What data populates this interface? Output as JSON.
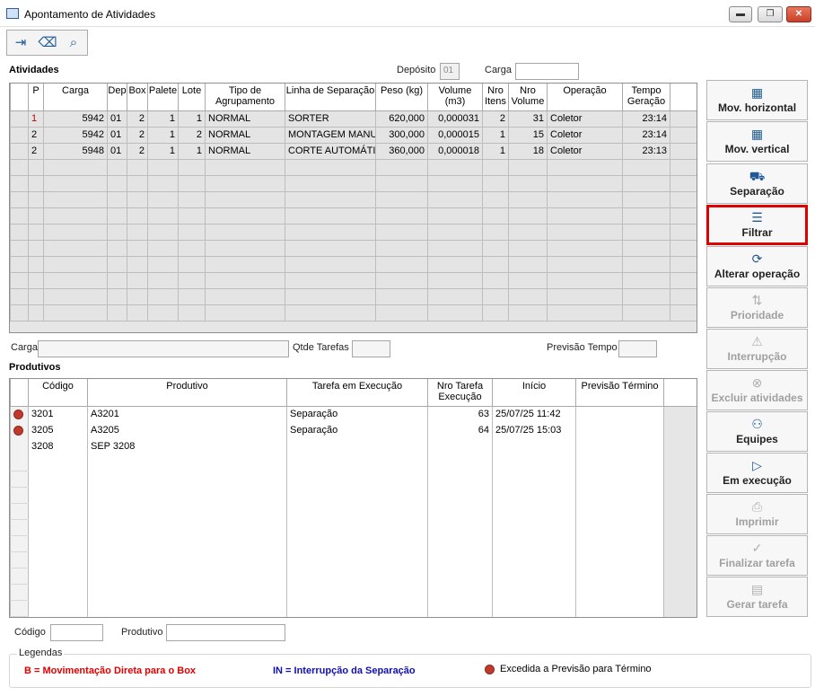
{
  "window": {
    "title": "Apontamento de Atividades",
    "minimize_label": "▬",
    "maximize_label": "❐",
    "close_label": "✕"
  },
  "toolbar": {
    "exit_icon": "exit-icon",
    "eraser_icon": "eraser-icon",
    "search_icon": "search-icon"
  },
  "atividades": {
    "section_title": "Atividades",
    "deposito_label": "Depósito",
    "deposito_value": "01",
    "carga_label": "Carga",
    "carga_value": "",
    "columns": [
      "P",
      "Carga",
      "Dep",
      "Box",
      "Palete",
      "Lote",
      "Tipo de Agrupamento",
      "Linha de Separação",
      "Peso (kg)",
      "Volume (m3)",
      "Nro Itens",
      "Nro Volume",
      "Operação",
      "Tempo Geração"
    ],
    "rows": [
      {
        "p": "1",
        "carga": "5942",
        "dep": "01",
        "box": "2",
        "palete": "1",
        "lote": "1",
        "tipo": "NORMAL",
        "linha": "SORTER",
        "peso": "620,000",
        "volume": "0,000031",
        "itens": "2",
        "nro_volume": "31",
        "operacao": "Coletor",
        "tempo": "23:14"
      },
      {
        "p": "2",
        "carga": "5942",
        "dep": "01",
        "box": "2",
        "palete": "1",
        "lote": "2",
        "tipo": "NORMAL",
        "linha": "MONTAGEM MANU",
        "peso": "300,000",
        "volume": "0,000015",
        "itens": "1",
        "nro_volume": "15",
        "operacao": "Coletor",
        "tempo": "23:14"
      },
      {
        "p": "2",
        "carga": "5948",
        "dep": "01",
        "box": "2",
        "palete": "1",
        "lote": "1",
        "tipo": "NORMAL",
        "linha": "CORTE AUTOMÁTI",
        "peso": "360,000",
        "volume": "0,000018",
        "itens": "1",
        "nro_volume": "18",
        "operacao": "Coletor",
        "tempo": "23:13"
      }
    ]
  },
  "info": {
    "carga_label": "Carga",
    "carga_value": "",
    "qtde_label": "Qtde Tarefas",
    "qtde_value": "",
    "previsao_label": "Previsão Tempo",
    "previsao_value": ""
  },
  "produtivos": {
    "section_title": "Produtivos",
    "columns": [
      "Código",
      "Produtivo",
      "Tarefa em Execução",
      "Nro Tarefa Execução",
      "Início",
      "Previsão Término"
    ],
    "rows": [
      {
        "status": "exceeded",
        "codigo": "3201",
        "produtivo": "A3201",
        "tarefa": "Separação",
        "nro": "63",
        "inicio": "25/07/25  11:42",
        "previsao": ""
      },
      {
        "status": "exceeded",
        "codigo": "3205",
        "produtivo": "A3205",
        "tarefa": "Separação",
        "nro": "64",
        "inicio": "25/07/25  15:03",
        "previsao": ""
      },
      {
        "status": "",
        "codigo": "3208",
        "produtivo": "SEP 3208",
        "tarefa": "",
        "nro": "",
        "inicio": "",
        "previsao": ""
      }
    ]
  },
  "filters": {
    "codigo_label": "Código",
    "codigo_value": "",
    "produtivo_label": "Produtivo",
    "produtivo_value": ""
  },
  "side_buttons": [
    {
      "label": "Mov. horizontal",
      "icon": "grid-icon",
      "enabled": true
    },
    {
      "label": "Mov. vertical",
      "icon": "grid-icon",
      "enabled": true
    },
    {
      "label": "Separação",
      "icon": "hand-truck-icon",
      "enabled": true
    },
    {
      "label": "Filtrar",
      "icon": "filter-icon",
      "enabled": true,
      "highlighted": true
    },
    {
      "label": "Alterar operação",
      "icon": "refresh-icon",
      "enabled": true
    },
    {
      "label": "Prioridade",
      "icon": "sort-arrows-icon",
      "enabled": false
    },
    {
      "label": "Interrupção",
      "icon": "warning-icon",
      "enabled": false
    },
    {
      "label": "Excluir atividades",
      "icon": "close-circle-icon",
      "enabled": false
    },
    {
      "label": "Equipes",
      "icon": "users-icon",
      "enabled": true
    },
    {
      "label": "Em execução",
      "icon": "play-icon",
      "enabled": true
    },
    {
      "label": "Imprimir",
      "icon": "printer-icon",
      "enabled": false
    },
    {
      "label": "Finalizar tarefa",
      "icon": "check-circle-icon",
      "enabled": false
    },
    {
      "label": "Gerar tarefa",
      "icon": "document-icon",
      "enabled": false
    }
  ],
  "legend": {
    "title": "Legendas",
    "b_text": "B = Movimentação Direta para o Box",
    "b_color": "#e00000",
    "in_text": "IN = Interrupção da Separação",
    "in_color": "#1010b0",
    "dot_text": "Excedida a Previsão para Término",
    "dot_color": "#c0392b"
  }
}
